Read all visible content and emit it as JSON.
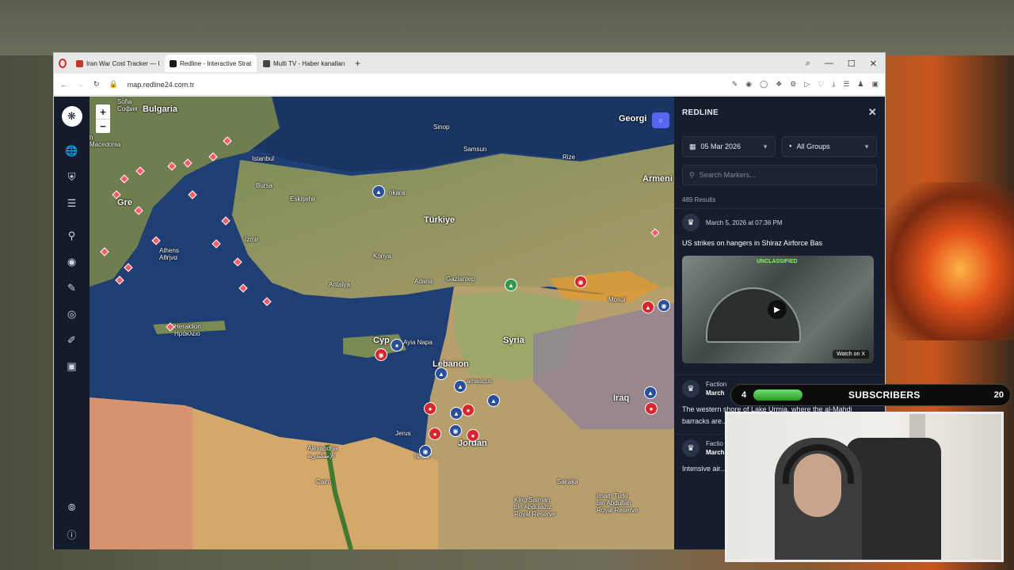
{
  "browser": {
    "tabs": [
      {
        "title": "Iran War Cost Tracker — I",
        "favicon_color": "#c0392b",
        "active": false
      },
      {
        "title": "Redline - Interactive Strat",
        "favicon_color": "#1a1a1a",
        "active": true
      },
      {
        "title": "Multi TV - Haber kanalları",
        "favicon_color": "#444444",
        "active": false
      }
    ],
    "new_tab": "+",
    "url": "map.redline24.com.tr",
    "window_controls": {
      "minimize": "—",
      "maximize": "☐",
      "close": "✕",
      "search": "⌕"
    }
  },
  "map": {
    "zoom_in": "+",
    "zoom_out": "−",
    "discord_icon": "discord-icon",
    "labels": {
      "sofia": "Sofia\nСофия",
      "bulgaria": "Bulgaria",
      "macedonia": "h\nMacedonia",
      "istanbul": "Istanbul",
      "bursa": "Bursa",
      "eskisehir": "Eskişehir",
      "ankara": "nkara",
      "turkiye": "Türkiye",
      "izmir": "İzmir",
      "konya": "Konya",
      "antalya": "Antalya",
      "adana": "Adana",
      "gaziantep": "Gaziantep",
      "syria": "Syria",
      "cyprus": "Cyp",
      "lebanon": "Lebanon",
      "damascus": "amascus",
      "iraq": "Iraq",
      "jordan": "Jordan",
      "jerusalem": "Jerus",
      "israel": "Israel",
      "alexandria": "Alexandria\nالإسكندرية",
      "cairo": "Cairo",
      "athens": "Athens\nΑθήνα",
      "greece": "Gre",
      "georgia": "Georgi",
      "armenia": "Armeni",
      "mosul": "Mosul",
      "heraklion": "Heraklion\nΗράκλειο",
      "ayanapa": "Ayia Napa",
      "samsun": "Samsun",
      "trabzon": "Rize",
      "sinop": "Sinop",
      "sakaka": "Sakaka",
      "king_salman": "King Salman\nbin Abdulaziz\nRoyal Reserve",
      "imam_turki": "Imam Turki\nbin Abdullah\nRoyal Reserve"
    }
  },
  "rail": {
    "icons": [
      "globe-icon",
      "shield-icon",
      "sliders-icon",
      "search-icon",
      "pin-icon",
      "ruler-icon",
      "target-icon",
      "pen-icon",
      "camera-icon"
    ],
    "bottom_icons": [
      "broadcast-icon",
      "info-icon"
    ]
  },
  "panel": {
    "title": "REDLINE",
    "close": "✕",
    "date_filter": "05 Mar 2026",
    "group_filter": "All Groups",
    "search_placeholder": "Search Markers...",
    "results_count": "489 Results",
    "cards": [
      {
        "timestamp": "March 5, 2026 at 07:36 PM",
        "title": "US strikes on hangers in Shiraz Airforce Bas",
        "video_tag": "UNCLASSIFIED",
        "watch_label": "Watch on X"
      },
      {
        "faction_label": "Faction",
        "date_prefix": "March",
        "body": "The western shore of Lake Urmia, where the al-Mahdi barracks are... result of airstrikes... airstrikes"
      },
      {
        "faction_label": "Factio",
        "date_prefix": "March",
        "body": "Intensive air... undergroun... structures ou... points."
      }
    ]
  },
  "overlay": {
    "subscribers_current": "4",
    "subscribers_label": "SUBSCRIBERS",
    "subscribers_goal": "20",
    "progress_fraction": 0.2
  }
}
